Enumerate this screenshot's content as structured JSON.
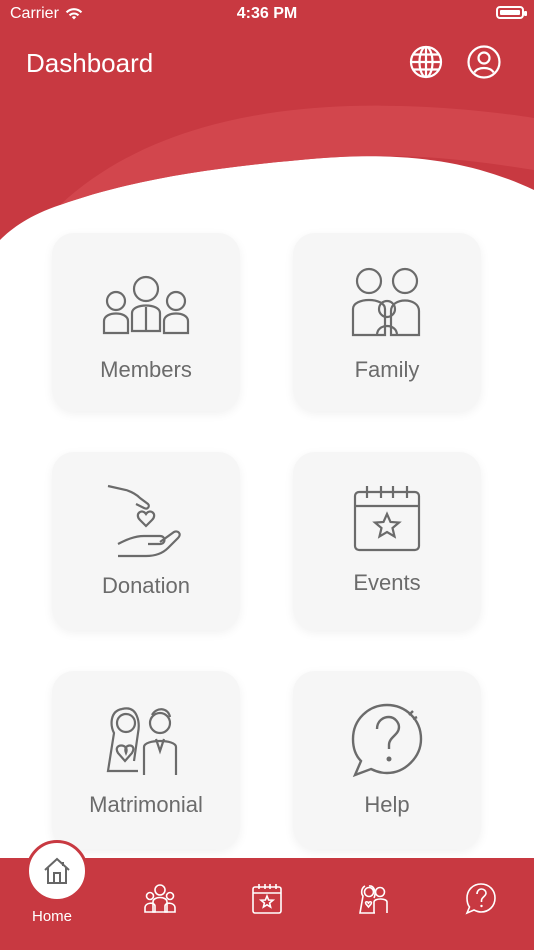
{
  "status_bar": {
    "carrier": "Carrier",
    "time": "4:36 PM"
  },
  "header": {
    "title": "Dashboard",
    "globe_icon": "globe-icon",
    "profile_icon": "user-circle-icon",
    "color": "#c83941"
  },
  "tiles": [
    {
      "label": "Members",
      "icon": "members-group-icon"
    },
    {
      "label": "Family",
      "icon": "family-icon"
    },
    {
      "label": "Donation",
      "icon": "donation-heart-hand-icon"
    },
    {
      "label": "Events",
      "icon": "calendar-star-icon"
    },
    {
      "label": "Matrimonial",
      "icon": "couple-icon"
    },
    {
      "label": "Help",
      "icon": "question-bubble-icon"
    }
  ],
  "bottom_nav": {
    "home_label": "Home",
    "items": [
      "home-icon",
      "members-icon",
      "calendar-icon",
      "couple-icon",
      "help-icon"
    ]
  }
}
